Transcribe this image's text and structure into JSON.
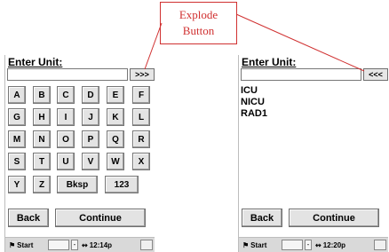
{
  "left_screen": {
    "title": "Enter Unit:",
    "input_value": "",
    "toggle_label": ">>>",
    "keys_row1": [
      "A",
      "B",
      "C",
      "D",
      "E",
      "F"
    ],
    "keys_row2": [
      "G",
      "H",
      "I",
      "J",
      "K",
      "L"
    ],
    "keys_row3": [
      "M",
      "N",
      "O",
      "P",
      "Q",
      "R"
    ],
    "keys_row4": [
      "S",
      "T",
      "U",
      "V",
      "W",
      "X"
    ],
    "keys_row5": [
      "Y",
      "Z",
      "Bksp",
      "123"
    ],
    "back_label": "Back",
    "continue_label": "Continue",
    "taskbar": {
      "start_label": "Start",
      "time": "12:14p",
      "dash": "-"
    }
  },
  "right_screen": {
    "title": "Enter Unit:",
    "input_value": "",
    "toggle_label": "<<<",
    "list_items": [
      "ICU",
      "NICU",
      "RAD1"
    ],
    "back_label": "Back",
    "continue_label": "Continue",
    "taskbar": {
      "start_label": "Start",
      "time": "12:20p",
      "dash": "-"
    }
  },
  "callout": {
    "line1": "Explode",
    "line2": "Button"
  },
  "colors": {
    "callout": "#d03030",
    "button_face": "#e3e3e3",
    "taskbar": "#d9d9d9"
  }
}
